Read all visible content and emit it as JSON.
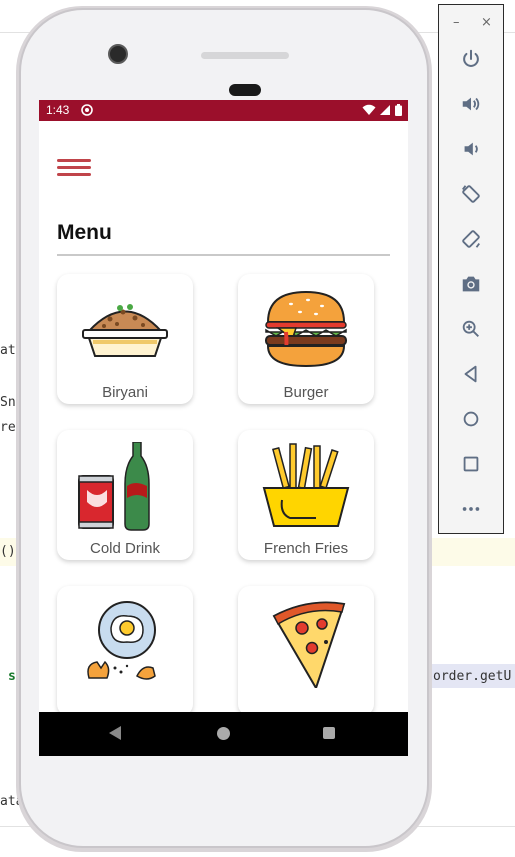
{
  "ide": {
    "code_fragments": [
      "ata",
      "Sn",
      "ren",
      "()",
      "s",
      "order.getU",
      "ata"
    ]
  },
  "emulator_panel": {
    "minimize": "–",
    "close": "×",
    "tools": [
      {
        "icon": "power-icon"
      },
      {
        "icon": "volume-up-icon"
      },
      {
        "icon": "volume-down-icon"
      },
      {
        "icon": "rotate-left-icon"
      },
      {
        "icon": "rotate-right-icon"
      },
      {
        "icon": "camera-icon"
      },
      {
        "icon": "zoom-icon"
      },
      {
        "icon": "back-icon"
      },
      {
        "icon": "home-icon"
      },
      {
        "icon": "overview-icon"
      },
      {
        "icon": "more-icon"
      }
    ]
  },
  "status_bar": {
    "time": "1:43",
    "color": "#9b0f2b"
  },
  "app": {
    "menu_icon": "hamburger-icon",
    "title": "Menu",
    "accent": "#c0444a",
    "items": [
      {
        "label": "Biryani",
        "icon": "biryani-icon"
      },
      {
        "label": "Burger",
        "icon": "burger-icon"
      },
      {
        "label": "Cold Drink",
        "icon": "cold-drink-icon"
      },
      {
        "label": "French Fries",
        "icon": "french-fries-icon"
      },
      {
        "label": "",
        "icon": "egg-icon"
      },
      {
        "label": "",
        "icon": "pizza-icon"
      }
    ]
  }
}
